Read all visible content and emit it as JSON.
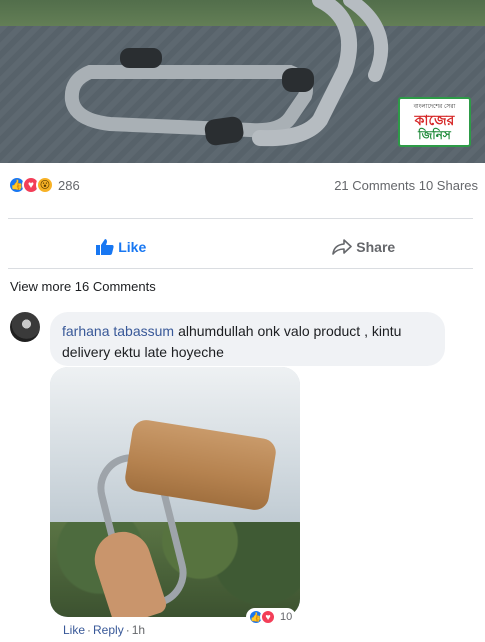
{
  "post": {
    "reactions_count": "286",
    "comments_shares": "21 Comments 10 Shares",
    "logo": {
      "top": "বাংলাদেশের সেরা",
      "main": "কাজের",
      "sub": "জিনিস"
    }
  },
  "actions": {
    "like_label": "Like",
    "share_label": "Share"
  },
  "comments": {
    "view_more": "View more 16 Comments",
    "items": [
      {
        "author": "farhana tabassum",
        "text": "alhumdullah onk valo product , kintu delivery ektu late hoyeche",
        "attachment_reactions": "10",
        "like_label": "Like",
        "reply_label": "Reply",
        "time": "1h"
      }
    ]
  },
  "colors": {
    "accent": "#1877f2",
    "love": "#f33e58",
    "wow": "#f7b125",
    "author": "#385898"
  }
}
